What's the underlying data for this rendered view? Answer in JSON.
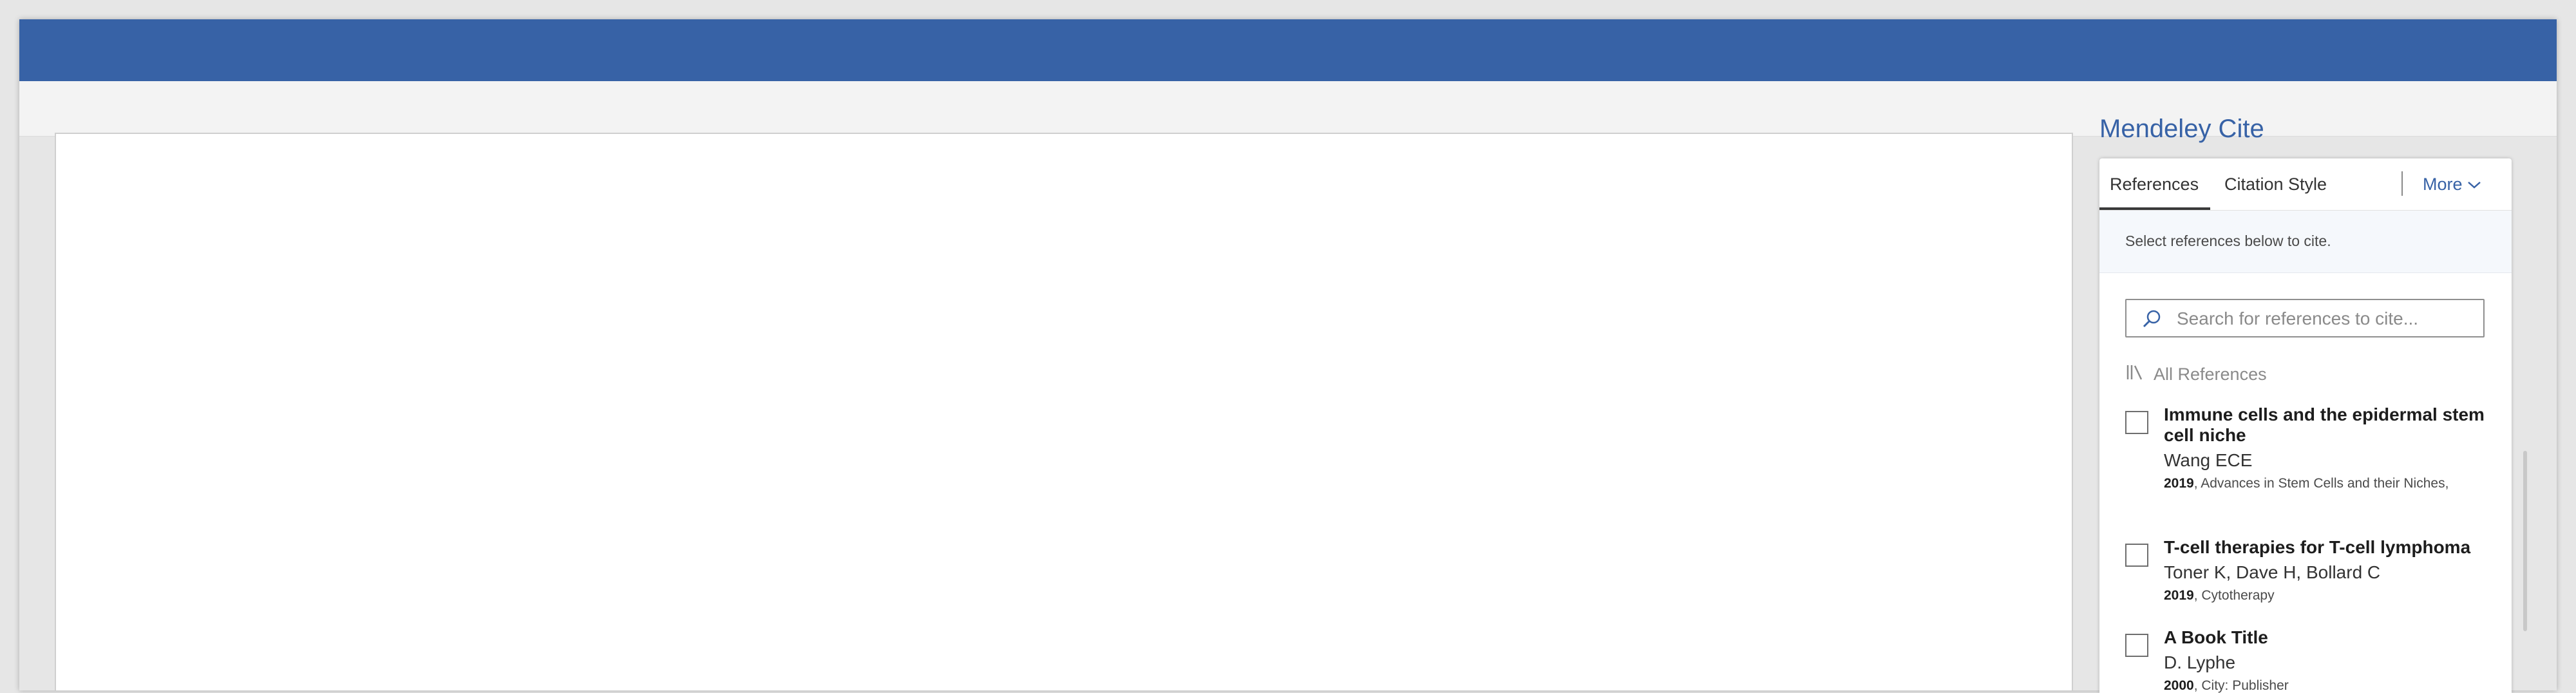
{
  "pane": {
    "title": "Mendeley Cite"
  },
  "tabs": {
    "references": "References",
    "citation_style": "Citation Style",
    "more": "More"
  },
  "info": "Select references below to cite.",
  "search": {
    "placeholder": "Search for references to cite..."
  },
  "library": {
    "label": "All References"
  },
  "references": [
    {
      "title": "Immune cells and the epidermal stem cell niche",
      "authors": "Wang ECE",
      "year": "2019",
      "source": ", Advances in Stem Cells and their Niches,"
    },
    {
      "title": "T-cell therapies for T-cell lymphoma",
      "authors": "Toner K, Dave H, Bollard C",
      "year": "2019",
      "source": ", Cytotherapy"
    },
    {
      "title": "A Book Title",
      "authors": "D. Lyphe",
      "year": "2000",
      "source": ", City: Publisher"
    }
  ],
  "colors": {
    "titlebar": "#3762a6",
    "accent": "#3762a6"
  },
  "icons": [
    "search-icon",
    "library-icon",
    "chevron-down-icon"
  ]
}
